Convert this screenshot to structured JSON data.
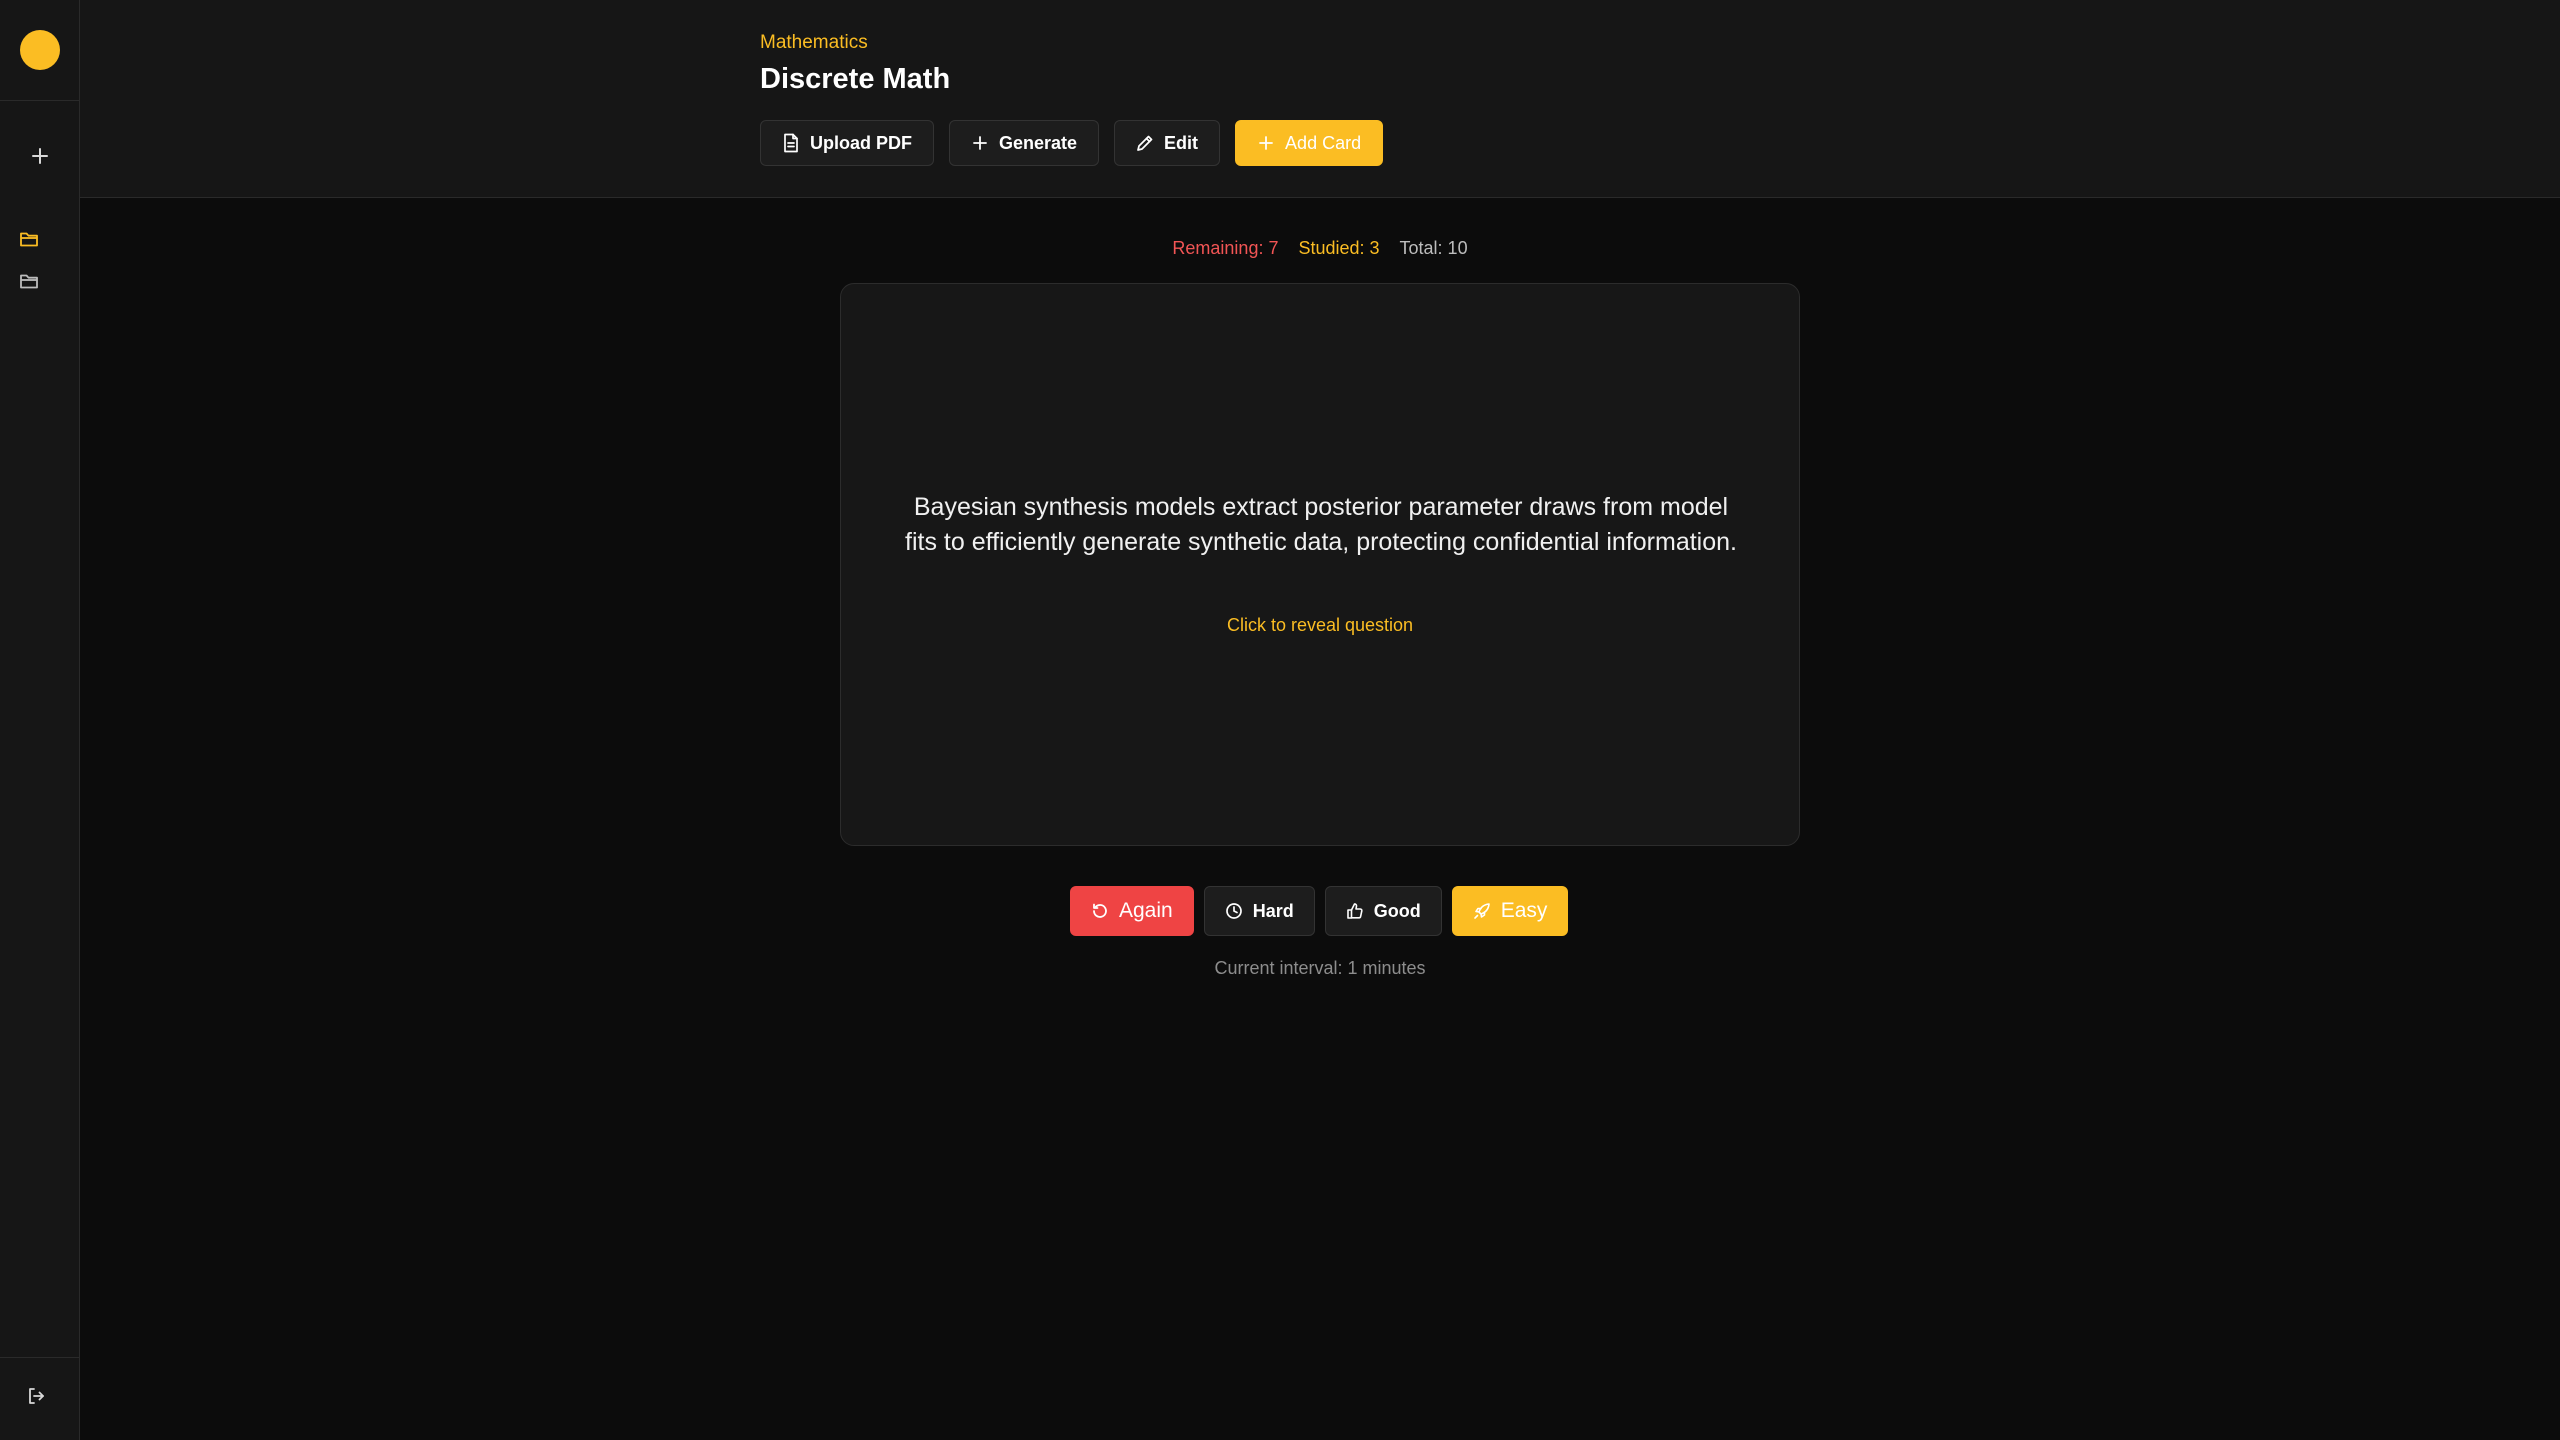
{
  "sidebar": {
    "logo_color": "#fbbd23",
    "new_icon": "plus-icon",
    "folders": [
      {
        "icon": "folder-icon",
        "active": true,
        "color": "#fbbd23"
      },
      {
        "icon": "folder-icon",
        "active": false,
        "color": "#bdbdbd"
      }
    ],
    "logout_icon": "logout-icon"
  },
  "header": {
    "breadcrumb": "Mathematics",
    "title": "Discrete Math",
    "toolbar": {
      "upload_label": "Upload PDF",
      "generate_label": "Generate",
      "edit_label": "Edit",
      "add_card_label": "Add Card"
    }
  },
  "stats": {
    "remaining": "Remaining: 7",
    "studied": "Studied: 3",
    "total": "Total: 10"
  },
  "card": {
    "text": "Bayesian synthesis models extract posterior parameter draws from model fits to efficiently generate synthetic data, protecting confidential information.",
    "hint": "Click to reveal question"
  },
  "rating": {
    "again_label": "Again",
    "hard_label": "Hard",
    "good_label": "Good",
    "easy_label": "Easy"
  },
  "interval": "Current interval: 1 minutes",
  "colors": {
    "accent": "#fbbd23",
    "danger": "#ef4444",
    "background": "#0c0c0c",
    "panel": "#161616"
  }
}
